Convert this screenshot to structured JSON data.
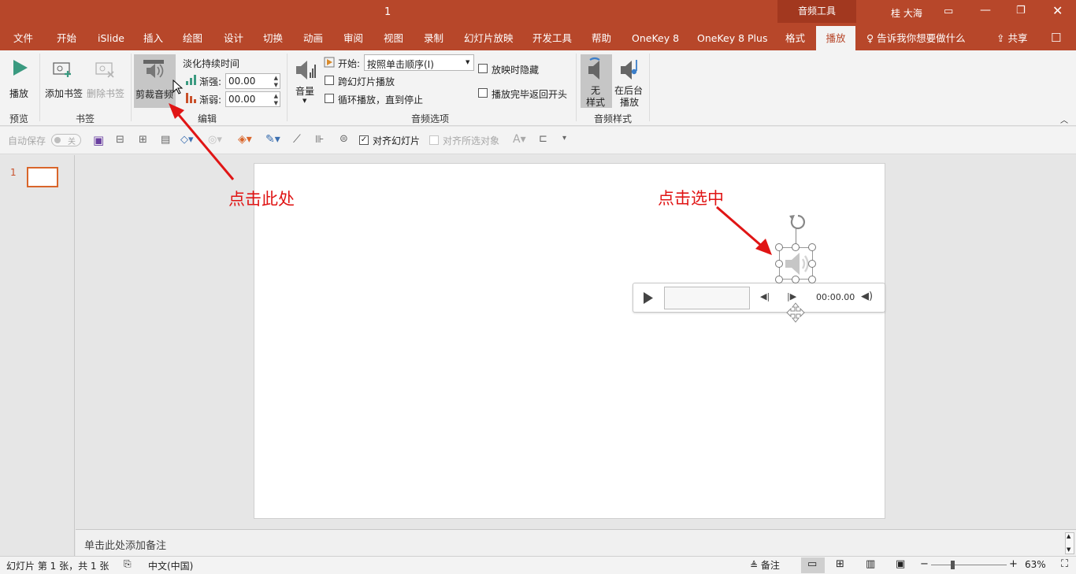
{
  "titlebar": {
    "doc_title": "1",
    "context_tab_header": "音频工具",
    "user_name": "桂 大海"
  },
  "tabs": [
    "文件",
    "开始",
    "iSlide",
    "插入",
    "绘图",
    "设计",
    "切换",
    "动画",
    "审阅",
    "视图",
    "录制",
    "幻灯片放映",
    "开发工具",
    "帮助",
    "OneKey 8",
    "OneKey 8 Plus",
    "格式",
    "播放"
  ],
  "active_tab": "播放",
  "tell_me": "告诉我你想要做什么",
  "share": "共享",
  "ribbon": {
    "preview": {
      "play_label": "播放",
      "group_label": "预览"
    },
    "bookmarks": {
      "add_label": "添加书签",
      "remove_label": "删除书签",
      "group_label": "书签"
    },
    "editing": {
      "trim_label": "剪裁音频",
      "fade_title": "淡化持续时间",
      "fade_in_label": "渐强:",
      "fade_in_value": "00.00",
      "fade_out_label": "渐弱:",
      "fade_out_value": "00.00",
      "group_label": "编辑"
    },
    "audio_options": {
      "volume_label": "音量",
      "start_label": "开始:",
      "start_value": "按照单击顺序(I)",
      "play_across_slides": "跨幻灯片播放",
      "loop_until_stopped": "循环播放，直到停止",
      "hide_during_show": "放映时隐藏",
      "rewind_after_playing": "播放完毕返回开头",
      "group_label": "音频选项"
    },
    "audio_styles": {
      "no_style": "无样式",
      "play_in_background": "在后台播放",
      "group_label": "音频样式"
    }
  },
  "qat": {
    "autosave_label": "自动保存",
    "autosave_state": "关",
    "align_to_slide": "对齐幻灯片",
    "align_selected": "对齐所选对象",
    "align_to_slide_checked": true
  },
  "slides": {
    "number": "1"
  },
  "audio_player": {
    "time": "00:00.00"
  },
  "annotations": {
    "click_here": "点击此处",
    "click_select": "点击选中"
  },
  "notes_placeholder": "单击此处添加备注",
  "status": {
    "slide_info": "幻灯片 第 1 张，共 1 张",
    "language": "中文(中国)",
    "notes_btn": "备注",
    "zoom": "63%"
  },
  "colors": {
    "accent": "#b7472a",
    "annotation": "#e01515"
  }
}
